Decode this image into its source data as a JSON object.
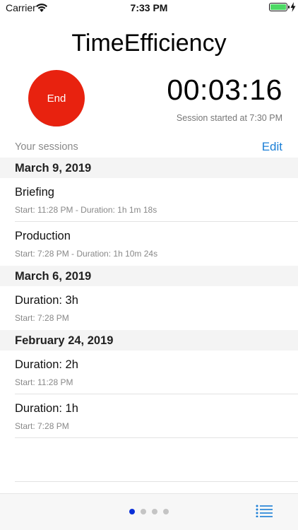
{
  "status_bar": {
    "carrier": "Carrier",
    "time": "7:33 PM"
  },
  "app_title": "TimeEfficiency",
  "timer": {
    "button_label": "End",
    "button_color": "#e8220f",
    "progress_color": "#2e9be0",
    "elapsed": "00:03:16",
    "session_started": "Session started at 7:30 PM"
  },
  "sessions_header": {
    "label": "Your sessions",
    "edit_label": "Edit"
  },
  "sections": [
    {
      "date": "March 9, 2019",
      "items": [
        {
          "title": "Briefing",
          "subtitle": "Start: 11:28 PM - Duration: 1h 1m 18s"
        },
        {
          "title": "Production",
          "subtitle": "Start: 7:28 PM - Duration: 1h 10m 24s"
        }
      ]
    },
    {
      "date": "March 6, 2019",
      "items": [
        {
          "title": "Duration: 3h",
          "subtitle": "Start: 7:28 PM"
        }
      ]
    },
    {
      "date": "February 24, 2019",
      "items": [
        {
          "title": "Duration: 2h",
          "subtitle": "Start: 11:28 PM"
        },
        {
          "title": "Duration: 1h",
          "subtitle": "Start: 7:28 PM"
        }
      ]
    }
  ],
  "pager": {
    "active_color": "#0a2fd8",
    "inactive_color": "#c4c4c4"
  },
  "accent_color": "#1b7fd6",
  "icons": {
    "wifi": "wifi-icon",
    "battery": "battery-icon",
    "charging": "charging-bolt-icon",
    "list": "list-icon"
  }
}
